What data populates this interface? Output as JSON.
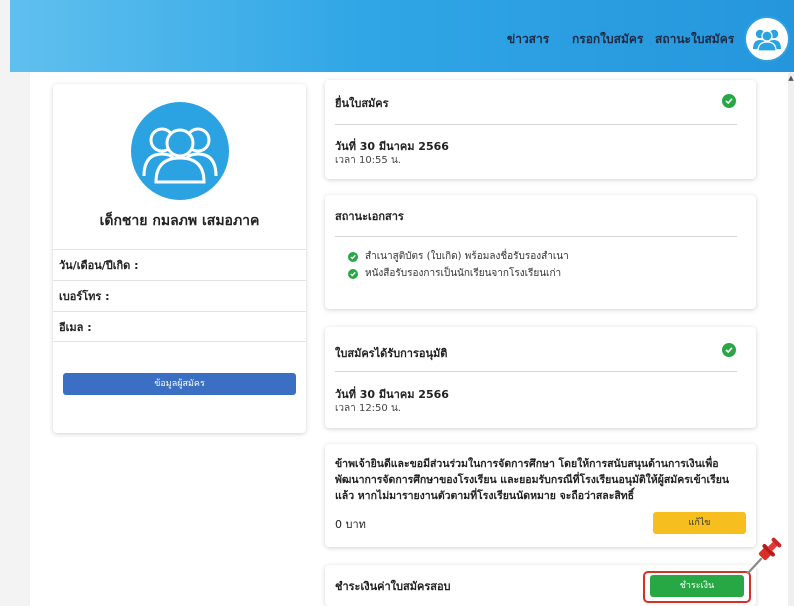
{
  "nav": {
    "news": "ข่าวสาร",
    "form": "กรอกใบสมัคร",
    "status": "สถานะใบสมัคร"
  },
  "profile": {
    "name": "เด็กชาย กมลภพ เสมอภาค",
    "birth_label": "วัน/เดือน/ปีเกิด :",
    "phone_label": "เบอร์โทร :",
    "email_label": "อีเมล :",
    "button_label": "ข้อมูลผู้สมัคร"
  },
  "submit": {
    "title": "ยื่นใบสมัคร",
    "date": "วันที่ 30 มีนาคม 2566",
    "time": "เวลา 10:55 น."
  },
  "documents": {
    "title": "สถานะเอกสาร",
    "items": [
      "สำเนาสูติบัตร (ใบเกิด) พร้อมลงชื่อรับรองสำเนา",
      "หนังสือรับรองการเป็นนักเรียนจากโรงเรียนเก่า"
    ]
  },
  "approved": {
    "title": "ใบสมัครได้รับการอนุมัติ",
    "date": "วันที่ 30 มีนาคม 2566",
    "time": "เวลา 12:50 น."
  },
  "donation": {
    "text": "ข้าพเจ้ายินดีและขอมีส่วนร่วมในการจัดการศึกษา โดยให้การสนับสนุนด้านการเงินเพื่อพัฒนาการจัดการศึกษาของโรงเรียน และยอมรับกรณีที่โรงเรียนอนุมัติให้ผู้สมัครเข้าเรียนแล้ว หากไม่มารายงานตัวตามที่โรงเรียนนัดหมาย จะถือว่าสละสิทธิ์",
    "amount": "0 บาท",
    "edit_label": "แก้ไข"
  },
  "payment": {
    "title": "ชำระเงินค่าใบสมัครสอบ",
    "button_label": "ชำระเงิน"
  },
  "colors": {
    "header_start": "#5fc0ee",
    "header_end": "#2596dc",
    "primary_button": "#3b6fc4",
    "success": "#28a745",
    "warning": "#f6be1f",
    "highlight": "#d93025"
  }
}
